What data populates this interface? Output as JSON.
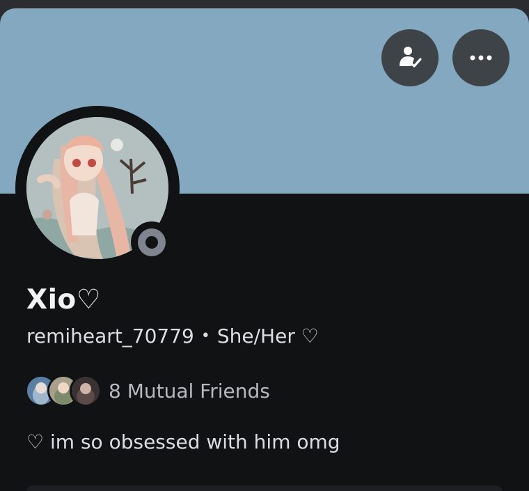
{
  "profile": {
    "display_name": "Xio♡",
    "username": "remiheart_70779",
    "separator": "•",
    "pronouns": "She/Her ♡",
    "mutual_friends": "8 Mutual Friends",
    "bio": "♡ im so obsessed with him omg",
    "status": "offline"
  },
  "actions": {
    "friend_icon": "friend-added-icon",
    "more_icon": "more-options-icon"
  },
  "colors": {
    "banner": "#83a8c0",
    "card_bg": "#111214",
    "button_bg": "#3e4348",
    "status_offline": "#80848e"
  }
}
